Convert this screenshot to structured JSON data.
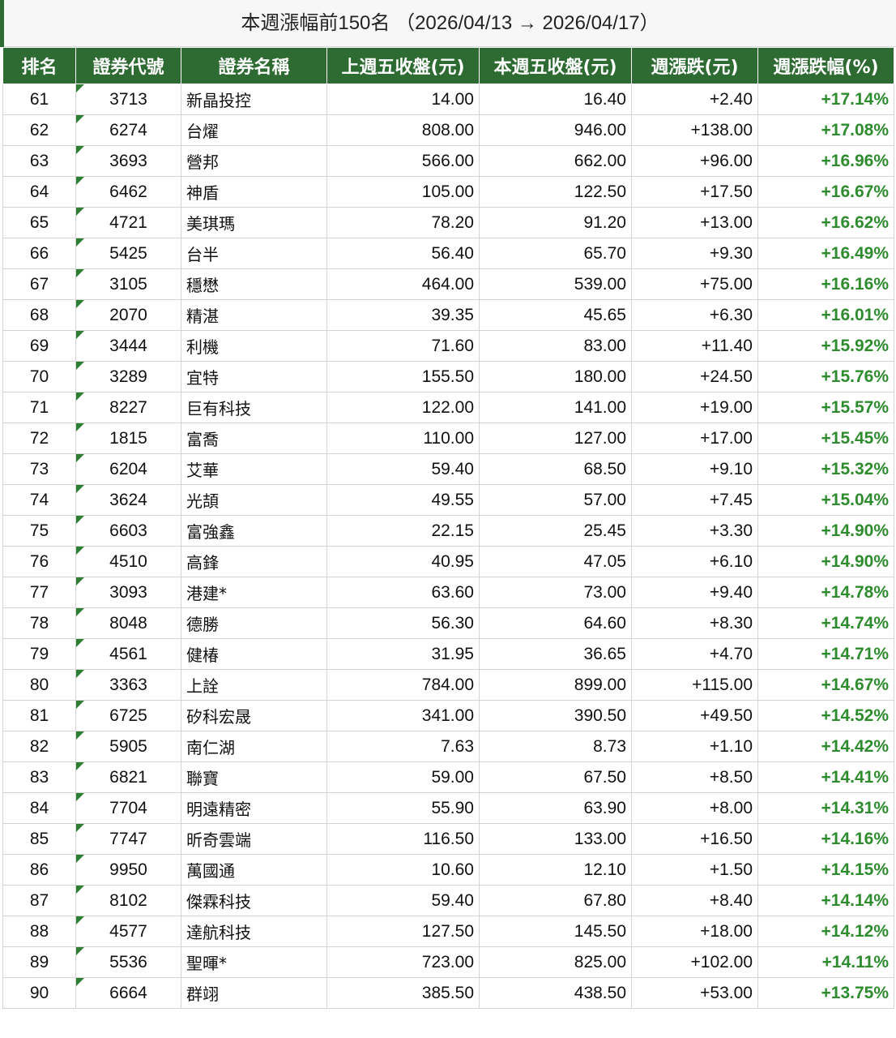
{
  "title": "本週漲幅前150名 （2026/04/13 → 2026/04/17）",
  "colors": {
    "header_bg": "#2e6b33",
    "header_text": "#ffffff",
    "gain_text": "#2e8b2e",
    "code_marker": "#2e7d32"
  },
  "table": {
    "headers": [
      "排名",
      "證券代號",
      "證券名稱",
      "上週五收盤(元)",
      "本週五收盤(元)",
      "週漲跌(元)",
      "週漲跌幅(%)"
    ],
    "rows": [
      {
        "rank": "61",
        "code": "3713",
        "name": "新晶投控",
        "prev_close": "14.00",
        "close": "16.40",
        "change": "+2.40",
        "pct": "+17.14%"
      },
      {
        "rank": "62",
        "code": "6274",
        "name": "台燿",
        "prev_close": "808.00",
        "close": "946.00",
        "change": "+138.00",
        "pct": "+17.08%"
      },
      {
        "rank": "63",
        "code": "3693",
        "name": "營邦",
        "prev_close": "566.00",
        "close": "662.00",
        "change": "+96.00",
        "pct": "+16.96%"
      },
      {
        "rank": "64",
        "code": "6462",
        "name": "神盾",
        "prev_close": "105.00",
        "close": "122.50",
        "change": "+17.50",
        "pct": "+16.67%"
      },
      {
        "rank": "65",
        "code": "4721",
        "name": "美琪瑪",
        "prev_close": "78.20",
        "close": "91.20",
        "change": "+13.00",
        "pct": "+16.62%"
      },
      {
        "rank": "66",
        "code": "5425",
        "name": "台半",
        "prev_close": "56.40",
        "close": "65.70",
        "change": "+9.30",
        "pct": "+16.49%"
      },
      {
        "rank": "67",
        "code": "3105",
        "name": "穩懋",
        "prev_close": "464.00",
        "close": "539.00",
        "change": "+75.00",
        "pct": "+16.16%"
      },
      {
        "rank": "68",
        "code": "2070",
        "name": "精湛",
        "prev_close": "39.35",
        "close": "45.65",
        "change": "+6.30",
        "pct": "+16.01%"
      },
      {
        "rank": "69",
        "code": "3444",
        "name": "利機",
        "prev_close": "71.60",
        "close": "83.00",
        "change": "+11.40",
        "pct": "+15.92%"
      },
      {
        "rank": "70",
        "code": "3289",
        "name": "宜特",
        "prev_close": "155.50",
        "close": "180.00",
        "change": "+24.50",
        "pct": "+15.76%"
      },
      {
        "rank": "71",
        "code": "8227",
        "name": "巨有科技",
        "prev_close": "122.00",
        "close": "141.00",
        "change": "+19.00",
        "pct": "+15.57%"
      },
      {
        "rank": "72",
        "code": "1815",
        "name": "富喬",
        "prev_close": "110.00",
        "close": "127.00",
        "change": "+17.00",
        "pct": "+15.45%"
      },
      {
        "rank": "73",
        "code": "6204",
        "name": "艾華",
        "prev_close": "59.40",
        "close": "68.50",
        "change": "+9.10",
        "pct": "+15.32%"
      },
      {
        "rank": "74",
        "code": "3624",
        "name": "光頡",
        "prev_close": "49.55",
        "close": "57.00",
        "change": "+7.45",
        "pct": "+15.04%"
      },
      {
        "rank": "75",
        "code": "6603",
        "name": "富強鑫",
        "prev_close": "22.15",
        "close": "25.45",
        "change": "+3.30",
        "pct": "+14.90%"
      },
      {
        "rank": "76",
        "code": "4510",
        "name": "高鋒",
        "prev_close": "40.95",
        "close": "47.05",
        "change": "+6.10",
        "pct": "+14.90%"
      },
      {
        "rank": "77",
        "code": "3093",
        "name": "港建*",
        "prev_close": "63.60",
        "close": "73.00",
        "change": "+9.40",
        "pct": "+14.78%"
      },
      {
        "rank": "78",
        "code": "8048",
        "name": "德勝",
        "prev_close": "56.30",
        "close": "64.60",
        "change": "+8.30",
        "pct": "+14.74%"
      },
      {
        "rank": "79",
        "code": "4561",
        "name": "健椿",
        "prev_close": "31.95",
        "close": "36.65",
        "change": "+4.70",
        "pct": "+14.71%"
      },
      {
        "rank": "80",
        "code": "3363",
        "name": "上詮",
        "prev_close": "784.00",
        "close": "899.00",
        "change": "+115.00",
        "pct": "+14.67%"
      },
      {
        "rank": "81",
        "code": "6725",
        "name": "矽科宏晟",
        "prev_close": "341.00",
        "close": "390.50",
        "change": "+49.50",
        "pct": "+14.52%"
      },
      {
        "rank": "82",
        "code": "5905",
        "name": "南仁湖",
        "prev_close": "7.63",
        "close": "8.73",
        "change": "+1.10",
        "pct": "+14.42%"
      },
      {
        "rank": "83",
        "code": "6821",
        "name": "聯寶",
        "prev_close": "59.00",
        "close": "67.50",
        "change": "+8.50",
        "pct": "+14.41%"
      },
      {
        "rank": "84",
        "code": "7704",
        "name": "明遠精密",
        "prev_close": "55.90",
        "close": "63.90",
        "change": "+8.00",
        "pct": "+14.31%"
      },
      {
        "rank": "85",
        "code": "7747",
        "name": "昕奇雲端",
        "prev_close": "116.50",
        "close": "133.00",
        "change": "+16.50",
        "pct": "+14.16%"
      },
      {
        "rank": "86",
        "code": "9950",
        "name": "萬國通",
        "prev_close": "10.60",
        "close": "12.10",
        "change": "+1.50",
        "pct": "+14.15%"
      },
      {
        "rank": "87",
        "code": "8102",
        "name": "傑霖科技",
        "prev_close": "59.40",
        "close": "67.80",
        "change": "+8.40",
        "pct": "+14.14%"
      },
      {
        "rank": "88",
        "code": "4577",
        "name": "達航科技",
        "prev_close": "127.50",
        "close": "145.50",
        "change": "+18.00",
        "pct": "+14.12%"
      },
      {
        "rank": "89",
        "code": "5536",
        "name": "聖暉*",
        "prev_close": "723.00",
        "close": "825.00",
        "change": "+102.00",
        "pct": "+14.11%"
      },
      {
        "rank": "90",
        "code": "6664",
        "name": "群翊",
        "prev_close": "385.50",
        "close": "438.50",
        "change": "+53.00",
        "pct": "+13.75%"
      }
    ]
  }
}
